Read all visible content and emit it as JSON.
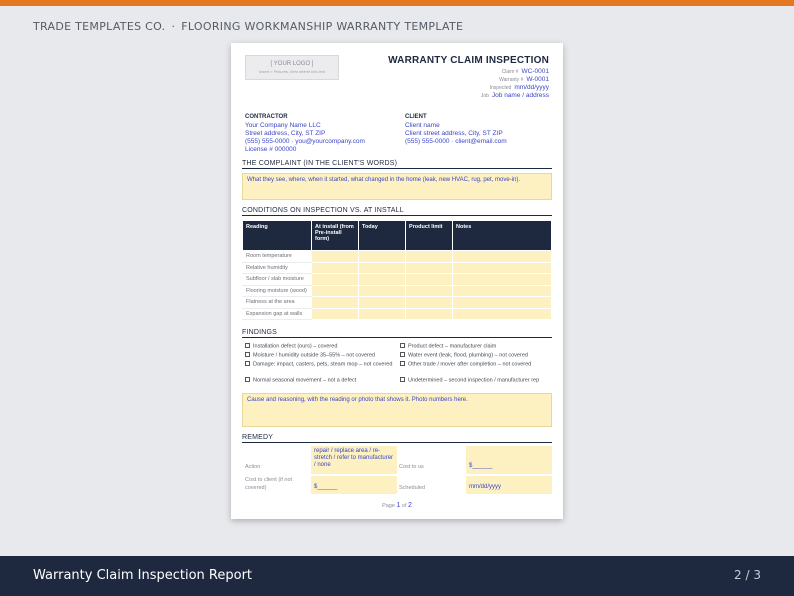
{
  "header": {
    "brand": "TRADE TEMPLATES CO.",
    "separator": "·",
    "template_name": "FLOORING WORKMANSHIP WARRANTY TEMPLATE"
  },
  "footer": {
    "title": "Warranty Claim Inspection Report",
    "pager": "2 / 3"
  },
  "doc": {
    "logo_text": "[ YOUR LOGO ]",
    "logo_hint": "Insert > Pictures, then delete this text",
    "title": "WARRANTY CLAIM INSPECTION",
    "meta": [
      {
        "key": "Claim #",
        "value": "WC-0001"
      },
      {
        "key": "Warranty #",
        "value": "W-0001"
      },
      {
        "key": "Inspected",
        "value": "mm/dd/yyyy"
      },
      {
        "key": "Job",
        "value": "Job name / address"
      }
    ],
    "contractor": {
      "heading": "CONTRACTOR",
      "lines": [
        "Your Company Name LLC",
        "Street address, City, ST ZIP",
        "(555) 555-0000 · you@yourcompany.com",
        "License # 000000"
      ]
    },
    "client": {
      "heading": "CLIENT",
      "lines": [
        "Client name",
        "Client street address, City, ST ZIP",
        "(555) 555-0000 · client@email.com"
      ]
    },
    "complaint": {
      "heading": "THE COMPLAINT (IN THE CLIENT'S WORDS)",
      "placeholder": "What they see, where, when it started, what changed in the home (leak, new HVAC, rug, pet, move-in)."
    },
    "conditions": {
      "heading": "CONDITIONS ON INSPECTION VS. AT INSTALL",
      "columns": [
        "Reading",
        "At install (from Pre-install form)",
        "Today",
        "Product limit",
        "Notes"
      ],
      "rows": [
        "Room temperature",
        "Relative humidity",
        "Subfloor / slab moisture",
        "Flooring moisture (wood)",
        "Flatness at the area",
        "Expansion gap at walls"
      ]
    },
    "findings": {
      "heading": "FINDINGS",
      "left": [
        "Installation defect (ours) – covered",
        "Moisture / humidity outside 35–55% – not covered",
        "Damage: impact, casters, pets, steam mop – not covered",
        "Normal seasonal movement – not a defect"
      ],
      "right": [
        "Product defect – manufacturer claim",
        "Water event (leak, flood, plumbing) – not covered",
        "Other trade / mover after completion – not covered",
        "Undetermined – second inspection / manufacturer rep"
      ],
      "reasoning": "Cause and reasoning, with the reading or photo that shows it. Photo numbers here."
    },
    "remedy": {
      "heading": "REMEDY",
      "action_label": "Action",
      "action_value": "repair / replace area / re-stretch / refer to manufacturer / none",
      "cost_us_label": "Cost to us",
      "cost_us_value": "$______",
      "cost_client_label": "Cost to client (if not covered)",
      "cost_client_value": "$______",
      "scheduled_label": "Scheduled",
      "scheduled_value": "mm/dd/yyyy"
    },
    "page": {
      "prefix": "Page",
      "current": "1",
      "of": "of",
      "total": "2"
    }
  }
}
